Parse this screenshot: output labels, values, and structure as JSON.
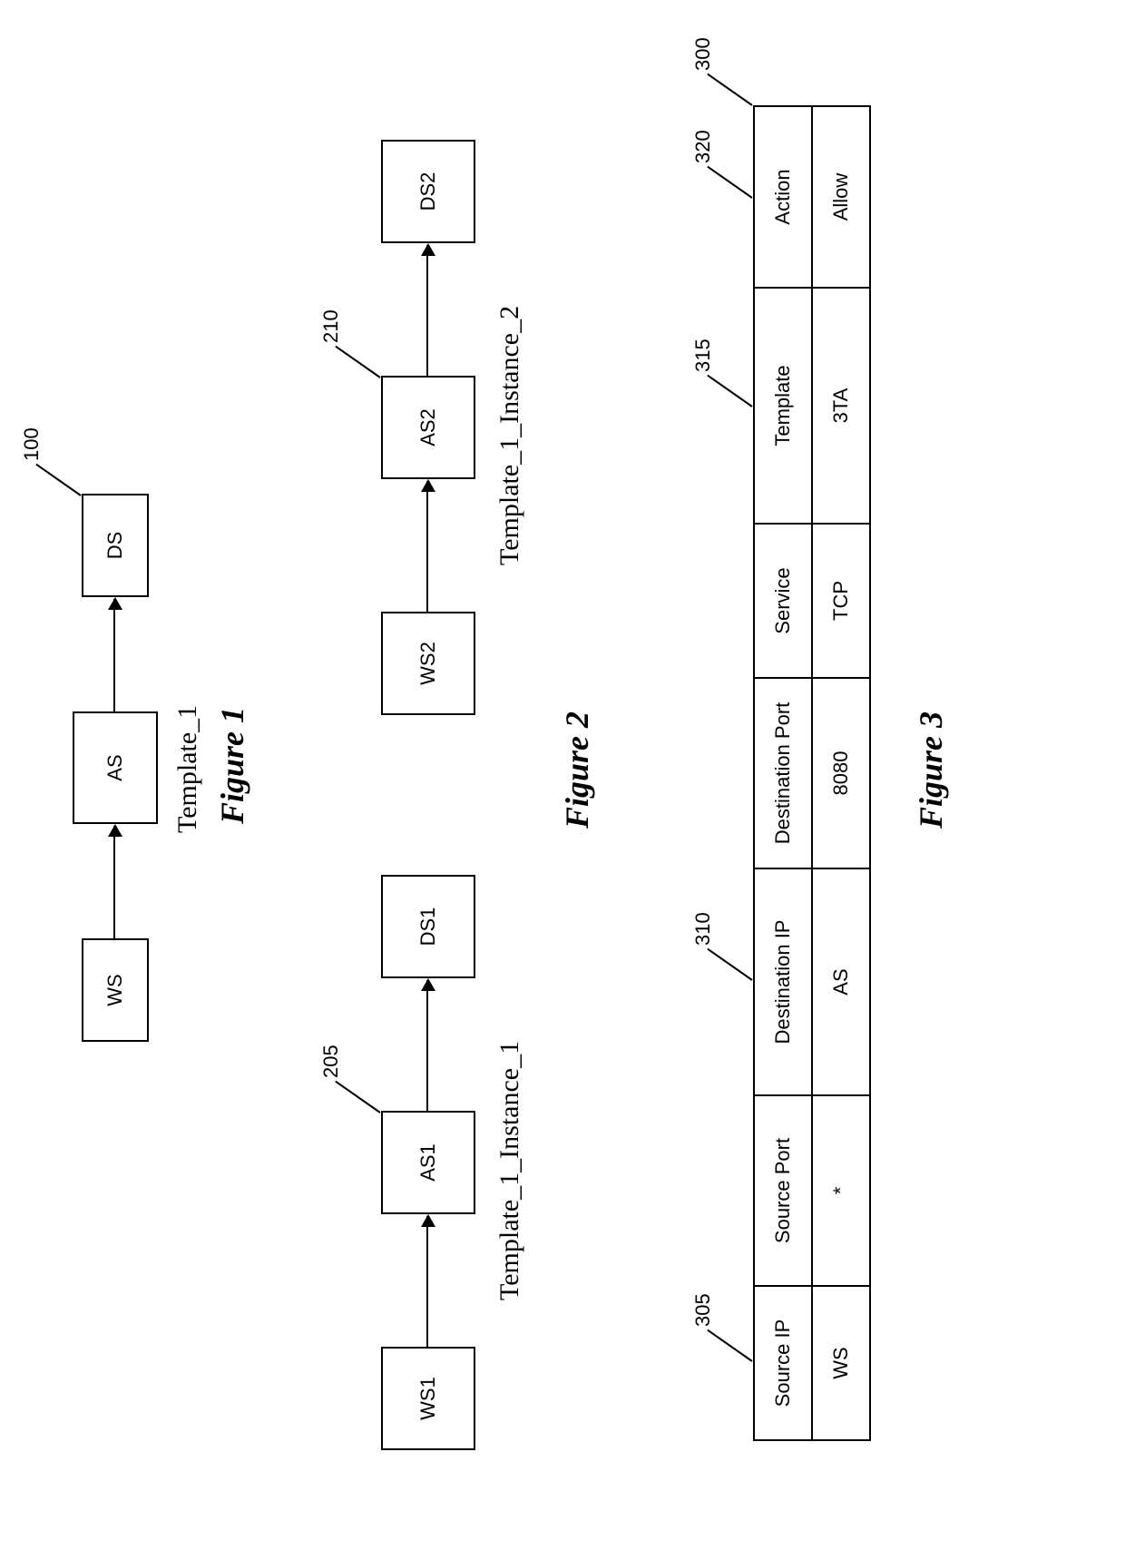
{
  "fig1": {
    "ref": "100",
    "nodes": {
      "ws": "WS",
      "as": "AS",
      "ds": "DS"
    },
    "caption": "Template_1",
    "title": "Figure 1"
  },
  "fig2": {
    "instances": [
      {
        "ref": "205",
        "nodes": {
          "ws": "WS1",
          "as": "AS1",
          "ds": "DS1"
        },
        "caption": "Template_1_Instance_1"
      },
      {
        "ref": "210",
        "nodes": {
          "ws": "WS2",
          "as": "AS2",
          "ds": "DS2"
        },
        "caption": "Template_1_Instance_2"
      }
    ],
    "title": "Figure 2"
  },
  "fig3": {
    "ref_table": "300",
    "columns": [
      {
        "ref": "305",
        "header": "Source IP"
      },
      {
        "ref": "",
        "header": "Source Port"
      },
      {
        "ref": "310",
        "header": "Destination IP"
      },
      {
        "ref": "",
        "header": "Destination Port"
      },
      {
        "ref": "",
        "header": "Service"
      },
      {
        "ref": "315",
        "header": "Template"
      },
      {
        "ref": "320",
        "header": "Action"
      }
    ],
    "row": [
      "WS",
      "*",
      "AS",
      "8080",
      "TCP",
      "3TA",
      "Allow"
    ],
    "title": "Figure 3"
  }
}
